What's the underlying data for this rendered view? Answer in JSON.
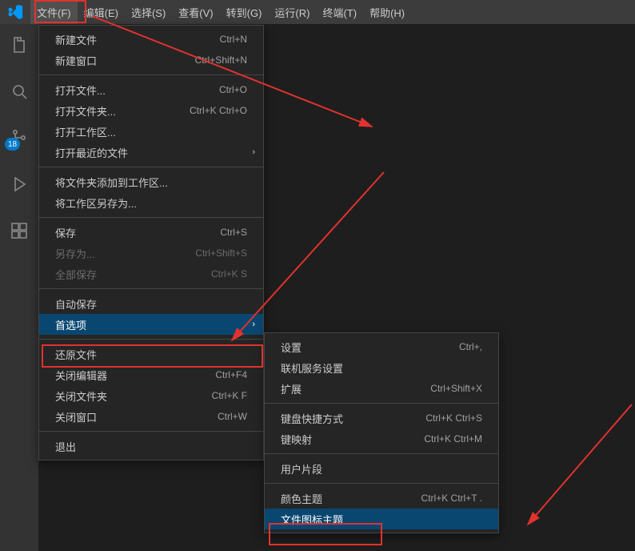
{
  "menubar": {
    "items": [
      "文件(F)",
      "编辑(E)",
      "选择(S)",
      "查看(V)",
      "转到(G)",
      "运行(R)",
      "终端(T)",
      "帮助(H)"
    ]
  },
  "activitybar": {
    "badge": "18"
  },
  "file_menu": {
    "groups": [
      [
        {
          "label": "新建文件",
          "shortcut": "Ctrl+N"
        },
        {
          "label": "新建窗口",
          "shortcut": "Ctrl+Shift+N"
        }
      ],
      [
        {
          "label": "打开文件...",
          "shortcut": "Ctrl+O"
        },
        {
          "label": "打开文件夹...",
          "shortcut": "Ctrl+K Ctrl+O"
        },
        {
          "label": "打开工作区..."
        },
        {
          "label": "打开最近的文件",
          "submenu": true
        }
      ],
      [
        {
          "label": "将文件夹添加到工作区..."
        },
        {
          "label": "将工作区另存为..."
        }
      ],
      [
        {
          "label": "保存",
          "shortcut": "Ctrl+S"
        },
        {
          "label": "另存为...",
          "shortcut": "Ctrl+Shift+S",
          "disabled": true
        },
        {
          "label": "全部保存",
          "shortcut": "Ctrl+K S",
          "disabled": true
        }
      ],
      [
        {
          "label": "自动保存"
        },
        {
          "label": "首选项",
          "submenu": true,
          "selected": true
        }
      ],
      [
        {
          "label": "还原文件"
        },
        {
          "label": "关闭编辑器",
          "shortcut": "Ctrl+F4"
        },
        {
          "label": "关闭文件夹",
          "shortcut": "Ctrl+K F"
        },
        {
          "label": "关闭窗口",
          "shortcut": "Ctrl+W"
        }
      ],
      [
        {
          "label": "退出"
        }
      ]
    ]
  },
  "pref_submenu": {
    "groups": [
      [
        {
          "label": "设置",
          "shortcut": "Ctrl+,"
        },
        {
          "label": "联机服务设置"
        },
        {
          "label": "扩展",
          "shortcut": "Ctrl+Shift+X"
        }
      ],
      [
        {
          "label": "键盘快捷方式",
          "shortcut": "Ctrl+K Ctrl+S"
        },
        {
          "label": "键映射",
          "shortcut": "Ctrl+K Ctrl+M"
        }
      ],
      [
        {
          "label": "用户片段"
        }
      ],
      [
        {
          "label": "颜色主题",
          "shortcut": "Ctrl+K Ctrl+T ."
        },
        {
          "label": "文件图标主题",
          "selected": true
        }
      ]
    ]
  }
}
